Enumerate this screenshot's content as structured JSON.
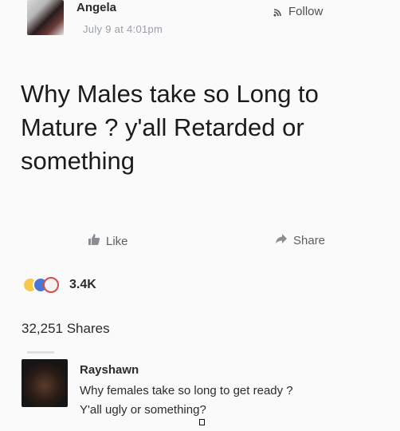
{
  "post": {
    "author": "Angela",
    "time": "July 9 at 4:01pm",
    "follow_label": "Follow",
    "text_lines": [
      "Why Males take so Long to",
      "Mature ? y'all Retarded or",
      "something"
    ]
  },
  "actions": {
    "like_label": "Like",
    "share_label": "Share"
  },
  "reactions": {
    "icons": [
      "haha-icon",
      "like-icon",
      "love-icon"
    ],
    "count": "3.4K"
  },
  "shares": {
    "text": "32,251 Shares"
  },
  "comment": {
    "author": "Rayshawn",
    "text_lines": [
      "Why females take so long to get ready ?",
      "Y'all ugly or something?"
    ]
  }
}
